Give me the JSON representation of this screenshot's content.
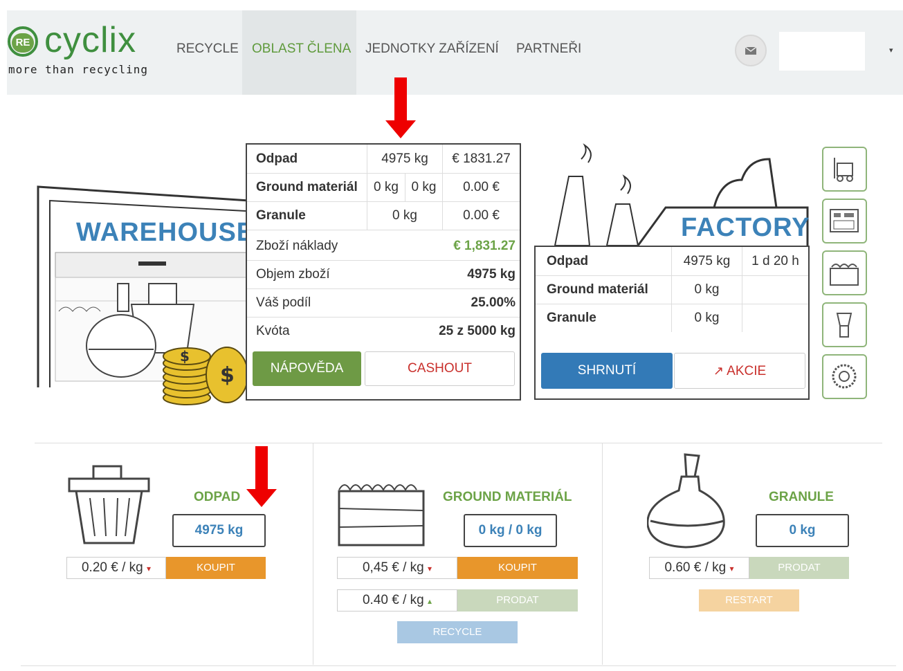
{
  "nav": {
    "logo_badge": "RE",
    "logo_word": "cyclix",
    "logo_tagline": "more than recycling",
    "menu": [
      "RECYCLE",
      "OBLAST ČLENA",
      "JEDNOTKY ZAŘÍZENÍ",
      "PARTNEŘI"
    ],
    "active_menu": "OBLAST ČLENA",
    "user_caret": "▾"
  },
  "warehouse": {
    "label": "WAREHOUSE",
    "table": [
      {
        "name": "Odpad",
        "a": "4975 kg",
        "b": "",
        "price": "€ 1831.27"
      },
      {
        "name": "Ground materiál",
        "a": "0 kg",
        "b": "0 kg",
        "price": "0.00 €"
      },
      {
        "name": "Granule",
        "a": "0 kg",
        "b": "",
        "price": "0.00 €"
      }
    ],
    "summary": [
      {
        "label": "Zboží náklady",
        "value": "€ 1,831.27"
      },
      {
        "label": "Objem zboží",
        "value": "4975 kg"
      },
      {
        "label": "Váš podíl",
        "value": "25.00%"
      },
      {
        "label": "Kvóta",
        "value": "25 z 5000 kg"
      }
    ],
    "help_button": "NÁPOVĚDA",
    "cashout_button": "CASHOUT"
  },
  "factory": {
    "label": "FACTORY",
    "table": [
      {
        "name": "Odpad",
        "qty": "4975 kg",
        "time": "1 d 20 h"
      },
      {
        "name": "Ground materiál",
        "qty": "0 kg",
        "time": ""
      },
      {
        "name": "Granule",
        "qty": "0 kg",
        "time": ""
      }
    ],
    "summary_button": "SHRNUTÍ",
    "action_button": "AKCIE"
  },
  "side_icons": [
    "forklift-icon",
    "control-panel-icon",
    "container-icon",
    "grinder-icon",
    "gear-machine-icon"
  ],
  "products": {
    "odpad": {
      "title": "ODPAD",
      "value": "4975 kg",
      "price": "0.20 € / kg",
      "price_arrow": "▾",
      "buy": "KOUPIT"
    },
    "ground": {
      "title": "GROUND MATERIÁL",
      "value": "0 kg / 0 kg",
      "buy_price": "0,45 € / kg",
      "buy_arrow": "▾",
      "buy": "KOUPIT",
      "sell_price": "0.40 € / kg",
      "sell_arrow": "▴",
      "sell": "PRODAT",
      "recycle": "RECYCLE"
    },
    "granule": {
      "title": "GRANULE",
      "value": "0 kg",
      "price": "0.60 € / kg",
      "price_arrow": "▾",
      "sell": "PRODAT",
      "restart": "RESTART"
    }
  },
  "colors": {
    "brand_green": "#3f8f3f",
    "help_green": "#6e9a45",
    "cashout_red": "#c9302c",
    "summary_blue": "#337ab7",
    "buy_orange": "#e8962b",
    "disabled_green": "#c9d8bc",
    "disabled_blue": "#a9c8e3",
    "disabled_orange": "#f5d3a0"
  }
}
